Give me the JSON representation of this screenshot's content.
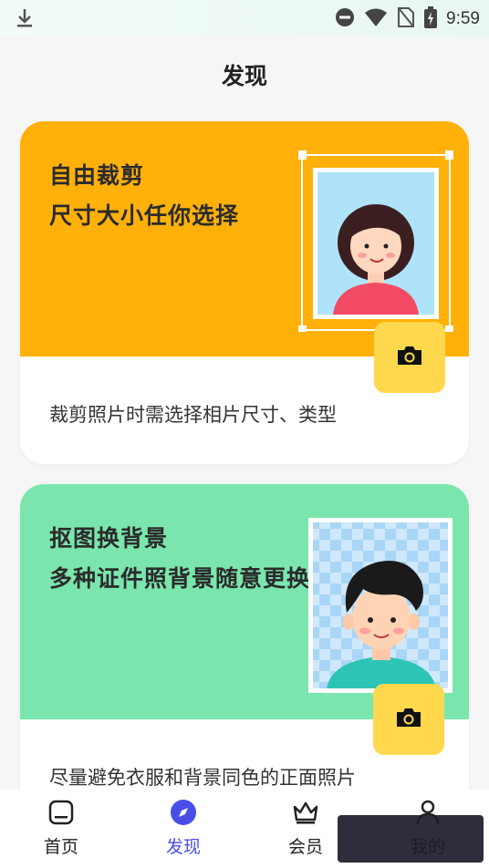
{
  "status_bar": {
    "time": "9:59"
  },
  "page": {
    "title": "发现"
  },
  "cards": [
    {
      "title_line1": "自由裁剪",
      "title_line2": "尺寸大小任你选择",
      "description": "裁剪照片时需选择相片尺寸、类型",
      "banner_color": "#ffb10a"
    },
    {
      "title_line1": "抠图换背景",
      "title_line2": "多种证件照背景随意更换",
      "description": "尽量避免衣服和背景同色的正面照片",
      "banner_color": "#7ae6ae"
    }
  ],
  "nav": {
    "items": [
      {
        "label": "首页",
        "icon": "home-icon"
      },
      {
        "label": "发现",
        "icon": "compass-icon",
        "active": true
      },
      {
        "label": "会员",
        "icon": "crown-icon"
      },
      {
        "label": "我的",
        "icon": "person-icon"
      }
    ]
  },
  "colors": {
    "accent": "#4a4ee8",
    "camera_button": "#ffd84d"
  }
}
